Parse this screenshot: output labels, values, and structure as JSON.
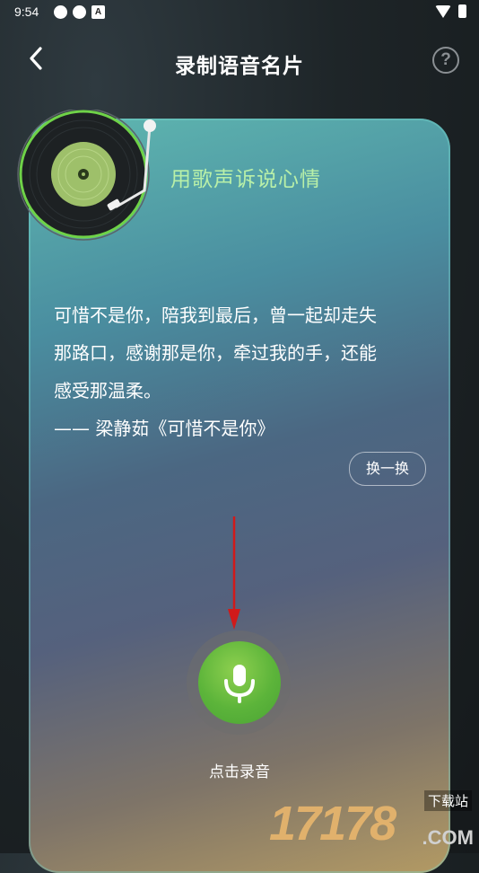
{
  "status_bar": {
    "time": "9:54",
    "icons_left": [
      "app-icon-1",
      "app-icon-2",
      "a-icon"
    ],
    "a_label": "A",
    "icons_right": [
      "wifi-icon",
      "battery-icon"
    ]
  },
  "header": {
    "title": "录制语音名片",
    "help_label": "?"
  },
  "card": {
    "title": "用歌声诉说心情",
    "lyrics_lines": [
      "可惜不是你，陪我到最后，曾一起却走失",
      "那路口，感谢那是你，牵过我的手，还能",
      "感受那温柔。",
      "—— 梁静茹《可惜不是你》"
    ],
    "swap_label": "换一换",
    "record_label": "点击录音"
  },
  "watermark": {
    "number": "17178",
    "download": "下载站",
    "domain": ".COM"
  },
  "colors": {
    "title_green": "#b9f0a8",
    "mic_green": "#5cb43a",
    "arrow_red": "#d11a1a",
    "watermark_orange": "#e9b66d"
  }
}
